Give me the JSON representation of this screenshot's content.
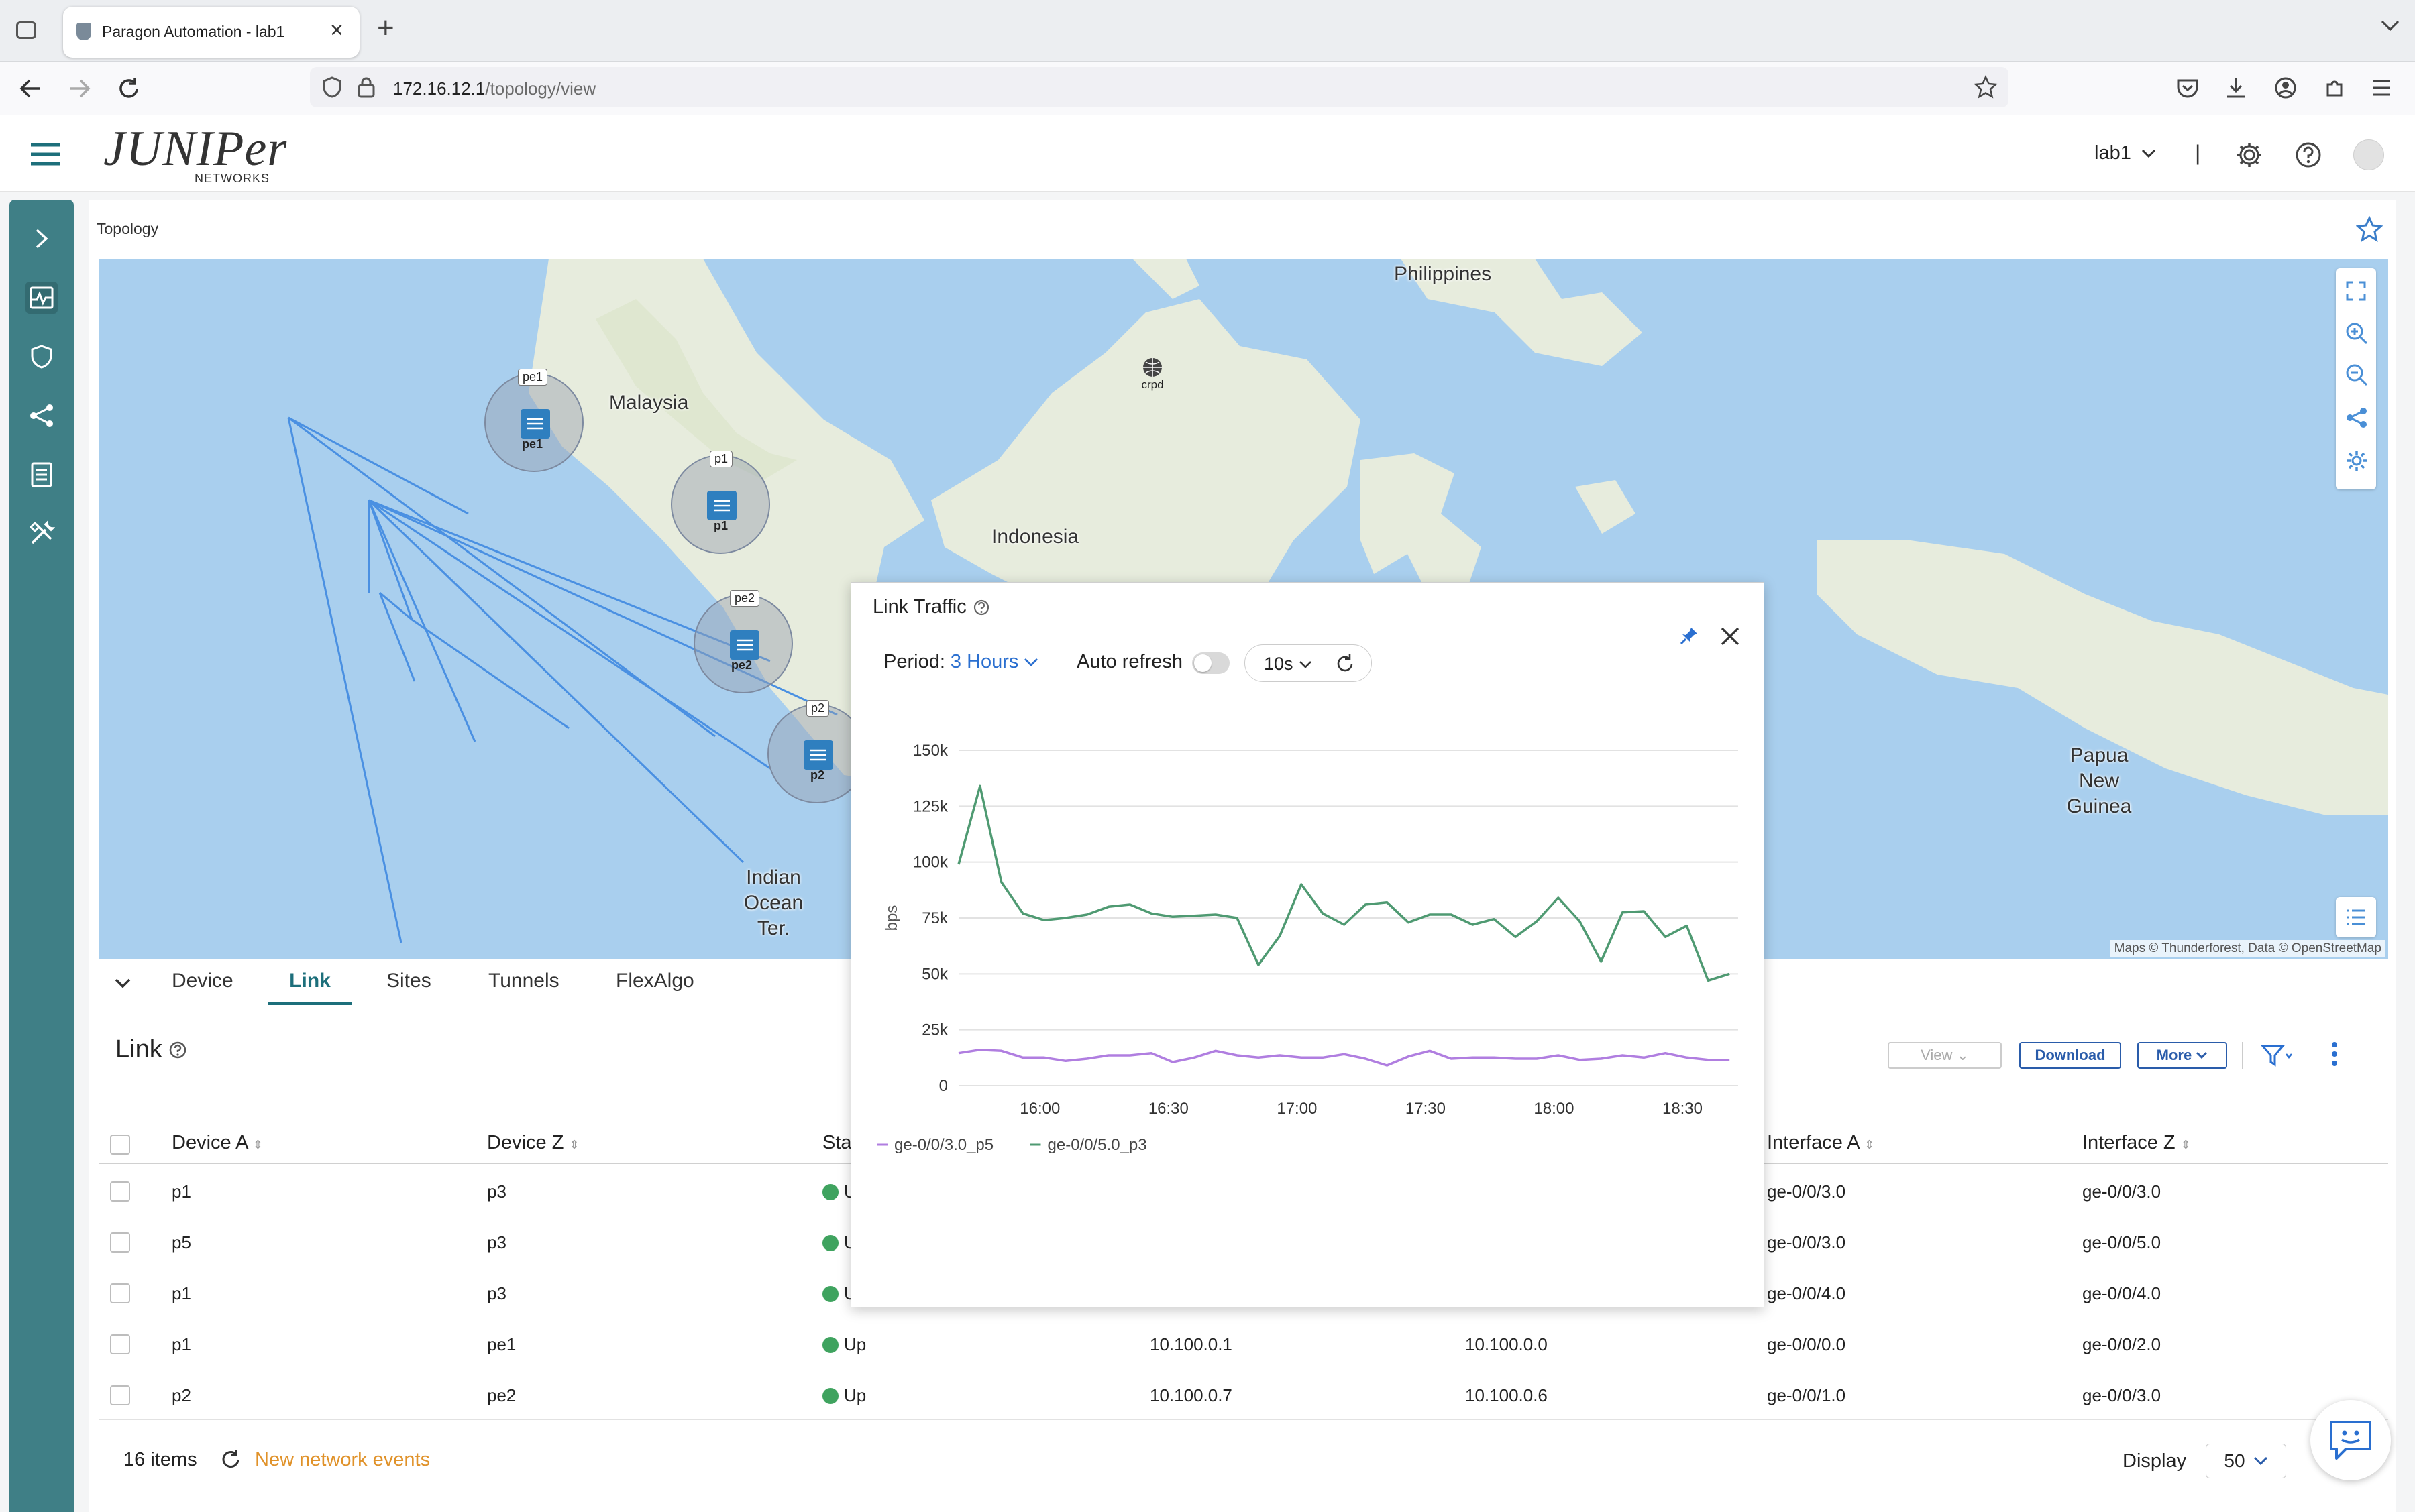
{
  "browser": {
    "tab_title": "Paragon Automation - lab1",
    "url_host": "172.16.12.1",
    "url_path": "/topology/view"
  },
  "header": {
    "logo_text": "JUNIPer",
    "logo_sub": "NETWORKS",
    "org_selector": "lab1",
    "divider": "|"
  },
  "page": {
    "breadcrumb": "Topology"
  },
  "map": {
    "labels": {
      "philippines": "Philippines",
      "malaysia": "Malaysia",
      "indonesia": "Indonesia",
      "papua": "Papua New Guinea",
      "indian_ocean": "Indian Ocean Ter."
    },
    "nodes": [
      {
        "id": "pe1",
        "tag": "pe1",
        "label": "pe1"
      },
      {
        "id": "p1",
        "tag": "p1",
        "label": "p1"
      },
      {
        "id": "pe2",
        "tag": "pe2",
        "label": "pe2"
      },
      {
        "id": "p2",
        "tag": "p2",
        "label": "p2"
      },
      {
        "id": "crpd",
        "label": "crpd"
      }
    ],
    "attribution": "Maps © Thunderforest, Data © OpenStreetMap"
  },
  "tabs": [
    "Device",
    "Link",
    "Sites",
    "Tunnels",
    "FlexAlgo"
  ],
  "active_tab": "Link",
  "link_section": {
    "title": "Link",
    "view_label": "View",
    "download_label": "Download",
    "more_label": "More",
    "columns": [
      "Device A",
      "Device Z",
      "Sta",
      "Interface A",
      "Interface Z"
    ],
    "rows": [
      {
        "device_a": "p1",
        "device_z": "p3",
        "status": "U",
        "ip_a": "",
        "ip_z": "",
        "if_a": "ge-0/0/3.0",
        "if_z": "ge-0/0/3.0"
      },
      {
        "device_a": "p5",
        "device_z": "p3",
        "status": "U",
        "ip_a": "",
        "ip_z": "",
        "if_a": "ge-0/0/3.0",
        "if_z": "ge-0/0/5.0"
      },
      {
        "device_a": "p1",
        "device_z": "p3",
        "status": "U",
        "ip_a": "",
        "ip_z": "",
        "if_a": "ge-0/0/4.0",
        "if_z": "ge-0/0/4.0"
      },
      {
        "device_a": "p1",
        "device_z": "pe1",
        "status": "Up",
        "ip_a": "10.100.0.1",
        "ip_z": "10.100.0.0",
        "if_a": "ge-0/0/0.0",
        "if_z": "ge-0/0/2.0"
      },
      {
        "device_a": "p2",
        "device_z": "pe2",
        "status": "Up",
        "ip_a": "10.100.0.7",
        "ip_z": "10.100.0.6",
        "if_a": "ge-0/0/1.0",
        "if_z": "ge-0/0/3.0"
      }
    ],
    "footer": {
      "items": "16 items",
      "events": "New network events",
      "display_label": "Display",
      "display_value": "50"
    }
  },
  "popup": {
    "title": "Link Traffic",
    "period_label": "Period:",
    "period_value": "3 Hours",
    "auto_refresh_label": "Auto refresh",
    "interval": "10s"
  },
  "colors": {
    "teal": "#3f7f86",
    "series_p5": "#b07ee0",
    "series_p3": "#4f9a72",
    "link_line": "#4a90e2"
  },
  "chart_data": {
    "type": "line",
    "title": "",
    "xlabel": "",
    "ylabel": "bps",
    "ylim": [
      0,
      150000
    ],
    "yticks": [
      "0",
      "25k",
      "50k",
      "75k",
      "100k",
      "125k",
      "150k"
    ],
    "yticks_values": [
      0,
      25000,
      50000,
      75000,
      100000,
      125000,
      150000
    ],
    "xlim": [
      "15:41",
      "18:43"
    ],
    "xticks": [
      "16:00",
      "16:30",
      "17:00",
      "17:30",
      "18:00",
      "18:30"
    ],
    "x": [
      "15:41",
      "15:46",
      "15:51",
      "15:56",
      "16:01",
      "16:06",
      "16:11",
      "16:16",
      "16:21",
      "16:26",
      "16:31",
      "16:36",
      "16:41",
      "16:46",
      "16:51",
      "16:56",
      "17:01",
      "17:06",
      "17:11",
      "17:16",
      "17:21",
      "17:26",
      "17:31",
      "17:36",
      "17:41",
      "17:46",
      "17:51",
      "17:56",
      "18:01",
      "18:06",
      "18:11",
      "18:16",
      "18:21",
      "18:26",
      "18:31",
      "18:36",
      "18:41"
    ],
    "series": [
      {
        "name": "ge-0/0/3.0_p5",
        "color": "#b07ee0",
        "values": [
          14500,
          16000,
          15500,
          12500,
          12500,
          11000,
          12000,
          13500,
          13500,
          14500,
          10500,
          12500,
          15500,
          13500,
          12500,
          13500,
          12500,
          12500,
          14000,
          12000,
          9000,
          13000,
          15500,
          12000,
          12500,
          12500,
          12000,
          12000,
          13500,
          11500,
          12000,
          13500,
          12500,
          14500,
          12500,
          11500,
          11500
        ]
      },
      {
        "name": "ge-0/0/5.0_p3",
        "color": "#4f9a72",
        "values": [
          99000,
          134000,
          91000,
          77000,
          74000,
          75000,
          76500,
          80000,
          81000,
          77000,
          75500,
          76000,
          76500,
          75000,
          54000,
          67000,
          90000,
          77000,
          72000,
          81000,
          82000,
          73000,
          76500,
          76500,
          72000,
          74500,
          66500,
          73500,
          84000,
          73500,
          55500,
          77500,
          78000,
          66500,
          71500,
          47000,
          50000
        ]
      }
    ]
  }
}
